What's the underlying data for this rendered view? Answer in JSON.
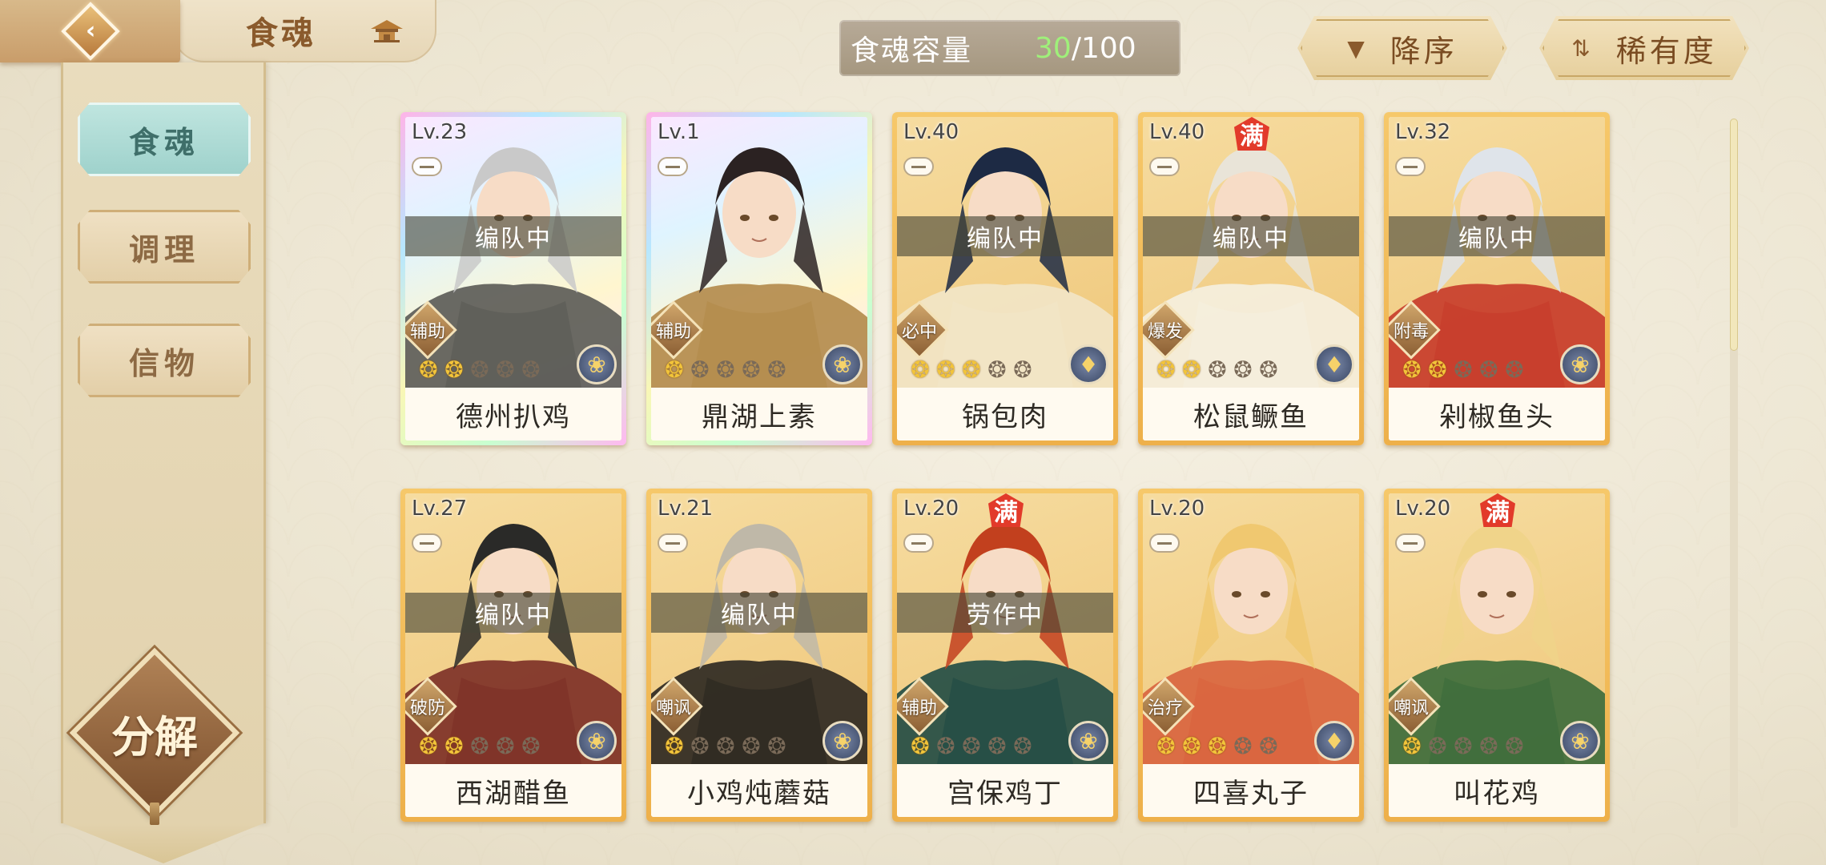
{
  "header": {
    "title": "食魂",
    "capacity_label": "食魂容量",
    "capacity_current": "30",
    "capacity_sep": "/",
    "capacity_max": "100",
    "sort_order_label": "降序",
    "sort_key_label": "稀有度"
  },
  "sidebar": {
    "tabs": [
      {
        "label": "食魂",
        "active": true
      },
      {
        "label": "调理",
        "active": false
      },
      {
        "label": "信物",
        "active": false
      }
    ],
    "decompose_label": "分解"
  },
  "cards": [
    {
      "level": "Lv.23",
      "name": "德州扒鸡",
      "status": "编队中",
      "role": "辅助",
      "stars": 2,
      "full": false,
      "rainbow": true,
      "accent": "#5a5a55",
      "hair": "#c9c9c9",
      "elem": "❀"
    },
    {
      "level": "Lv.1",
      "name": "鼎湖上素",
      "status": "",
      "role": "辅助",
      "stars": 1,
      "full": false,
      "rainbow": true,
      "accent": "#b28a4a",
      "hair": "#2b2222",
      "elem": "❀"
    },
    {
      "level": "Lv.40",
      "name": "锅包肉",
      "status": "编队中",
      "role": "必中",
      "stars": 3,
      "full": false,
      "rainbow": false,
      "accent": "#f2e6c8",
      "hair": "#1d2a44",
      "elem": "♦"
    },
    {
      "level": "Lv.40",
      "name": "松鼠鳜鱼",
      "status": "编队中",
      "role": "爆发",
      "stars": 2,
      "full": true,
      "rainbow": false,
      "accent": "#f5f0e0",
      "hair": "#e9e4d8",
      "elem": "♦"
    },
    {
      "level": "Lv.32",
      "name": "剁椒鱼头",
      "status": "编队中",
      "role": "附毒",
      "stars": 2,
      "full": false,
      "rainbow": false,
      "accent": "#c63a2a",
      "hair": "#dfe4ea",
      "elem": "❀"
    },
    {
      "level": "Lv.27",
      "name": "西湖醋鱼",
      "status": "编队中",
      "role": "破防",
      "stars": 2,
      "full": false,
      "rainbow": false,
      "accent": "#7b2e26",
      "hair": "#2a2a28",
      "elem": "❀"
    },
    {
      "level": "Lv.21",
      "name": "小鸡炖蘑菇",
      "status": "编队中",
      "role": "嘲讽",
      "stars": 1,
      "full": false,
      "rainbow": false,
      "accent": "#2a2620",
      "hair": "#bfb8a8",
      "elem": "❀"
    },
    {
      "level": "Lv.20",
      "name": "宫保鸡丁",
      "status": "劳作中",
      "role": "辅助",
      "stars": 1,
      "full": true,
      "rainbow": false,
      "accent": "#1f4a44",
      "hair": "#c2401e",
      "elem": "❀"
    },
    {
      "level": "Lv.20",
      "name": "四喜丸子",
      "status": "",
      "role": "治疗",
      "stars": 3,
      "full": false,
      "rainbow": false,
      "accent": "#d8633e",
      "hair": "#f0c870",
      "elem": "♦"
    },
    {
      "level": "Lv.20",
      "name": "叫花鸡",
      "status": "",
      "role": "嘲讽",
      "stars": 1,
      "full": true,
      "rainbow": false,
      "accent": "#3a6a3a",
      "hair": "#f0d48a",
      "elem": "❀"
    }
  ],
  "full_badge_label": "满",
  "icons": {
    "back": "chevron-left-icon",
    "home": "pagoda-icon",
    "sort_desc": "triangle-down-icon",
    "sort_key": "swap-icon",
    "flame_on": "🔥",
    "element": "element-icon"
  }
}
